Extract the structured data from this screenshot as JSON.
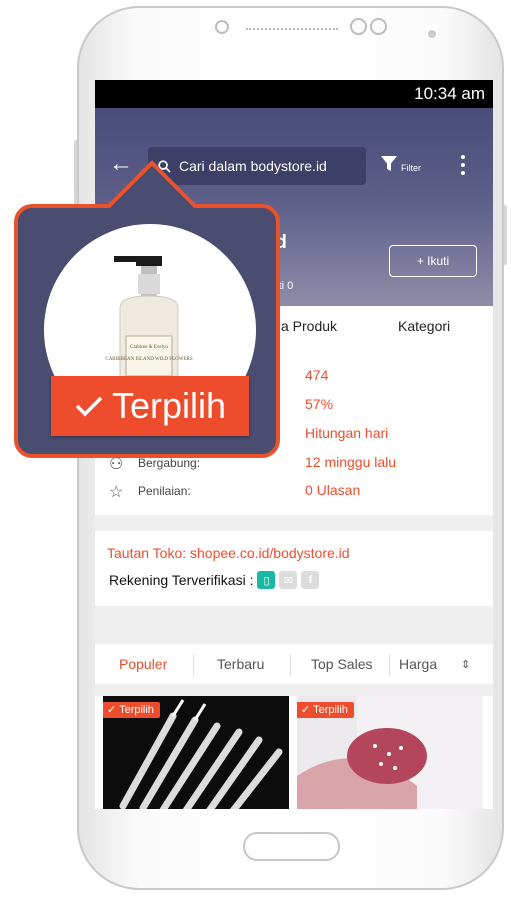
{
  "status_bar": {
    "time": "10:34 am"
  },
  "search": {
    "placeholder": "Cari dalam bodystore.id"
  },
  "filter": {
    "label": "Filter"
  },
  "shop": {
    "name_fragment": "id",
    "follow_fragment": "kuti 0",
    "follow_button": "+ Ikuti"
  },
  "tabs": [
    {
      "label": "a Produk"
    },
    {
      "label": "Kategori"
    }
  ],
  "stats": [
    {
      "label": "",
      "value": "474",
      "icon": "box-icon"
    },
    {
      "label": "",
      "value": "57%",
      "icon": "chat-icon"
    },
    {
      "label": "",
      "value": "Hitungan hari",
      "icon": "clock-icon"
    },
    {
      "label": "Bergabung:",
      "value": "12 minggu lalu",
      "icon": "people-icon"
    },
    {
      "label": "Penilaian:",
      "value": "0 Ulasan",
      "icon": "star-icon"
    }
  ],
  "shop_link": "Tautan Toko: shopee.co.id/bodystore.id",
  "verified": {
    "label": "Rekening Terverifikasi :"
  },
  "sort_tabs": [
    {
      "label": "Populer"
    },
    {
      "label": "Terbaru"
    },
    {
      "label": "Top Sales"
    },
    {
      "label": "Harga"
    }
  ],
  "products": [
    {
      "tag": "✓ Terpilih"
    },
    {
      "tag": "✓ Terpilih"
    }
  ],
  "callout": {
    "label": "Terpilih",
    "product_label": "CARIBBEAN ISLAND WILD FLOWERS"
  },
  "colors": {
    "accent": "#ee4d2d",
    "header": "#4a4d79",
    "verified": "#19b9a3"
  }
}
